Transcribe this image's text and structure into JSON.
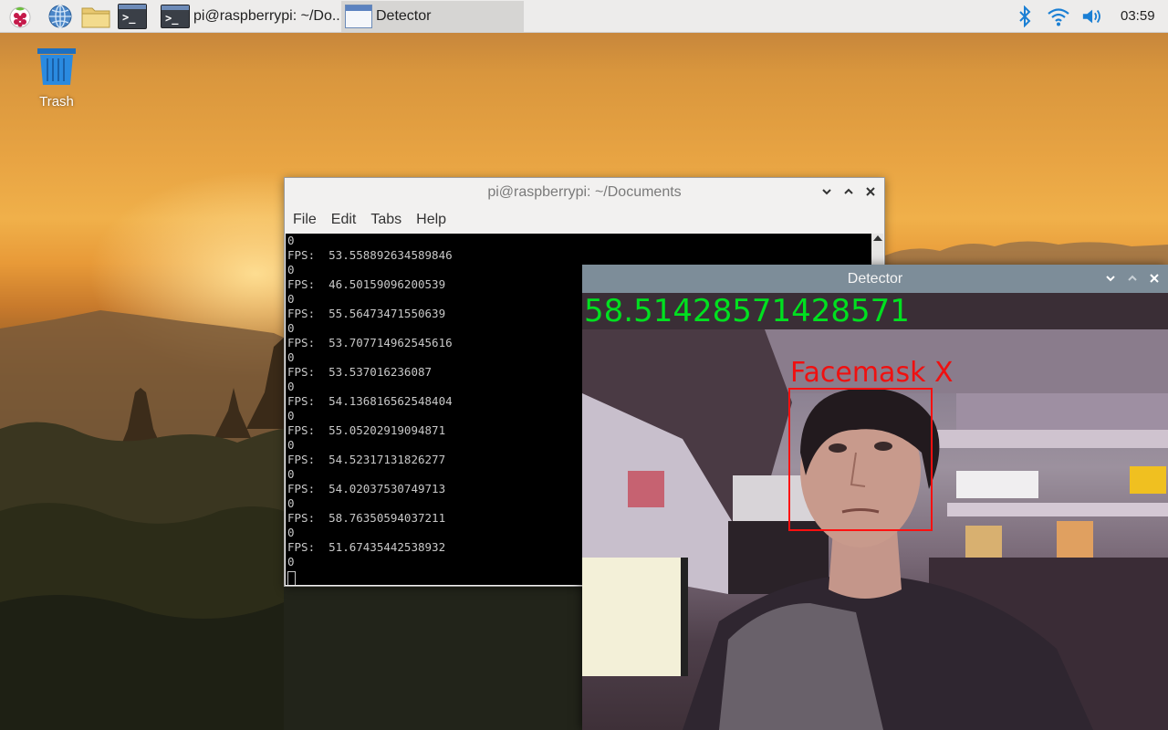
{
  "taskbar": {
    "tasks": [
      {
        "label": "pi@raspberrypi: ~/Do..."
      },
      {
        "label": "Detector"
      }
    ],
    "clock": "03:59"
  },
  "desktop": {
    "trash_label": "Trash"
  },
  "terminal": {
    "title": "pi@raspberrypi: ~/Documents",
    "menu": [
      "File",
      "Edit",
      "Tabs",
      "Help"
    ],
    "lines": [
      "0",
      "FPS:  53.558892634589846",
      "0",
      "FPS:  46.50159096200539",
      "0",
      "FPS:  55.56473471550639",
      "0",
      "FPS:  53.707714962545616",
      "0",
      "FPS:  53.537016236087",
      "0",
      "FPS:  54.136816562548404",
      "0",
      "FPS:  55.05202919094871",
      "0",
      "FPS:  54.52317131826277",
      "0",
      "FPS:  54.02037530749713",
      "0",
      "FPS:  58.76350594037211",
      "0",
      "FPS:  51.67435442538932",
      "0"
    ]
  },
  "detector": {
    "title": "Detector",
    "fps_overlay": "58.51428571428571",
    "detection_label": "Facemask X"
  },
  "colors": {
    "fps_text": "#00e020",
    "detection": "#ff1010",
    "detector_titlebar": "#7d8d99"
  }
}
